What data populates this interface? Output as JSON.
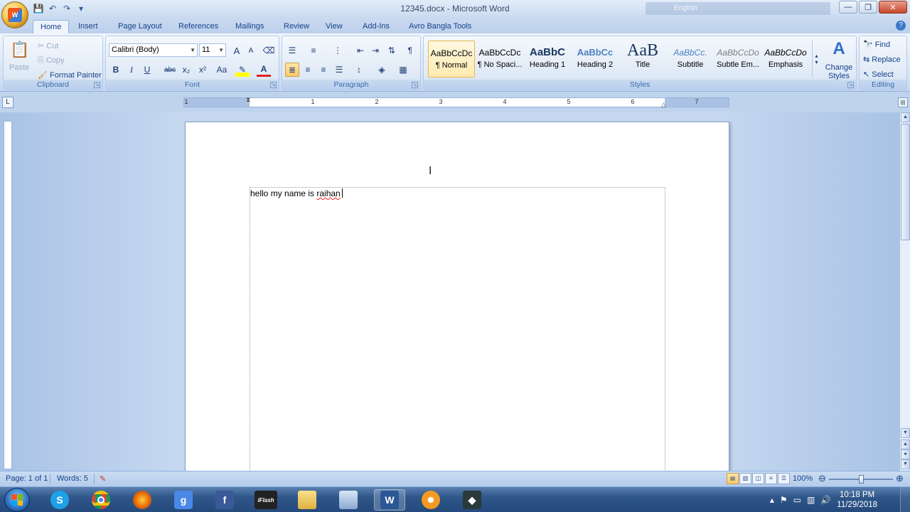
{
  "window": {
    "title": "12345.docx - Microsoft Word",
    "language_indicator": "English",
    "controls": [
      "—",
      "❐",
      "✕"
    ]
  },
  "quick_access": [
    "💾",
    "↶",
    "↷",
    "▾"
  ],
  "tabs": [
    "Home",
    "Insert",
    "Page Layout",
    "References",
    "Mailings",
    "Review",
    "View",
    "Add-Ins",
    "Avro Bangla Tools"
  ],
  "active_tab": "Home",
  "ribbon": {
    "clipboard": {
      "label": "Clipboard",
      "paste": "Paste",
      "cut": "Cut",
      "copy": "Copy",
      "format_painter": "Format Painter"
    },
    "font": {
      "label": "Font",
      "font_name": "Calibri (Body)",
      "font_size": "11",
      "bold": "B",
      "italic": "I",
      "underline": "U",
      "strike": "abc",
      "subscript": "x₂",
      "superscript": "x²",
      "change_case": "Aa",
      "grow": "A",
      "shrink": "A"
    },
    "paragraph": {
      "label": "Paragraph",
      "show_marks": "¶"
    },
    "styles": {
      "label": "Styles",
      "items": [
        {
          "sample": "AaBbCcDc",
          "name": "¶ Normal"
        },
        {
          "sample": "AaBbCcDc",
          "name": "¶ No Spaci..."
        },
        {
          "sample": "AaBbC",
          "name": "Heading 1"
        },
        {
          "sample": "AaBbCc",
          "name": "Heading 2"
        },
        {
          "sample": "AaB",
          "name": "Title"
        },
        {
          "sample": "AaBbCc.",
          "name": "Subtitle"
        },
        {
          "sample": "AaBbCcDo",
          "name": "Subtle Em..."
        },
        {
          "sample": "AaBbCcDo",
          "name": "Emphasis"
        }
      ],
      "change_styles": "Change Styles"
    },
    "editing": {
      "label": "Editing",
      "find": "Find",
      "replace": "Replace",
      "select": "Select"
    }
  },
  "document": {
    "text_plain": "hello my name is ",
    "text_misspelled": "raihan"
  },
  "ruler_numbers": [
    "1",
    "1",
    "2",
    "3",
    "4",
    "5",
    "6",
    "7"
  ],
  "status": {
    "page": "Page: 1 of 1",
    "words": "Words: 5",
    "zoom": "100%"
  },
  "taskbar": {
    "clock_time": "10:18 PM",
    "clock_date": "11/29/2018"
  }
}
